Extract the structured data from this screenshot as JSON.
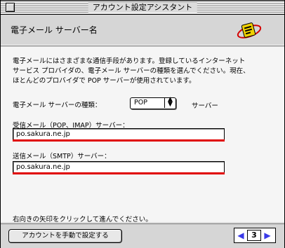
{
  "window": {
    "title": "アカウント設定アシスタント"
  },
  "header": {
    "title": "電子メール サーバー名",
    "icon": "email-icon"
  },
  "intro": {
    "line1": "電子メールにはさまざまな通信手段があります。登録しているインターネット",
    "line2": "サービス プロバイダの、電子メール サーバーの種類を選んでください。現在、",
    "line3": "ほとんどのプロバイダで POP サーバーが使用されています。"
  },
  "server_type": {
    "label": "電子メール サーバーの種類：",
    "value": "POP",
    "suffix": "サーバー"
  },
  "incoming": {
    "label": "受信メール（POP、IMAP）サーバー：",
    "value": "po.sakura.ne.jp"
  },
  "outgoing": {
    "label": "送信メール（SMTP）サーバー：",
    "value": "po.sakura.ne.jp"
  },
  "hint": "右向きの矢印をクリックして進んでください。",
  "footer": {
    "manual_button_label": "アカウントを手動で設定する",
    "page_number": "3"
  },
  "colors": {
    "underline": "#e00000",
    "nav_arrow": "#3a3ae8"
  }
}
